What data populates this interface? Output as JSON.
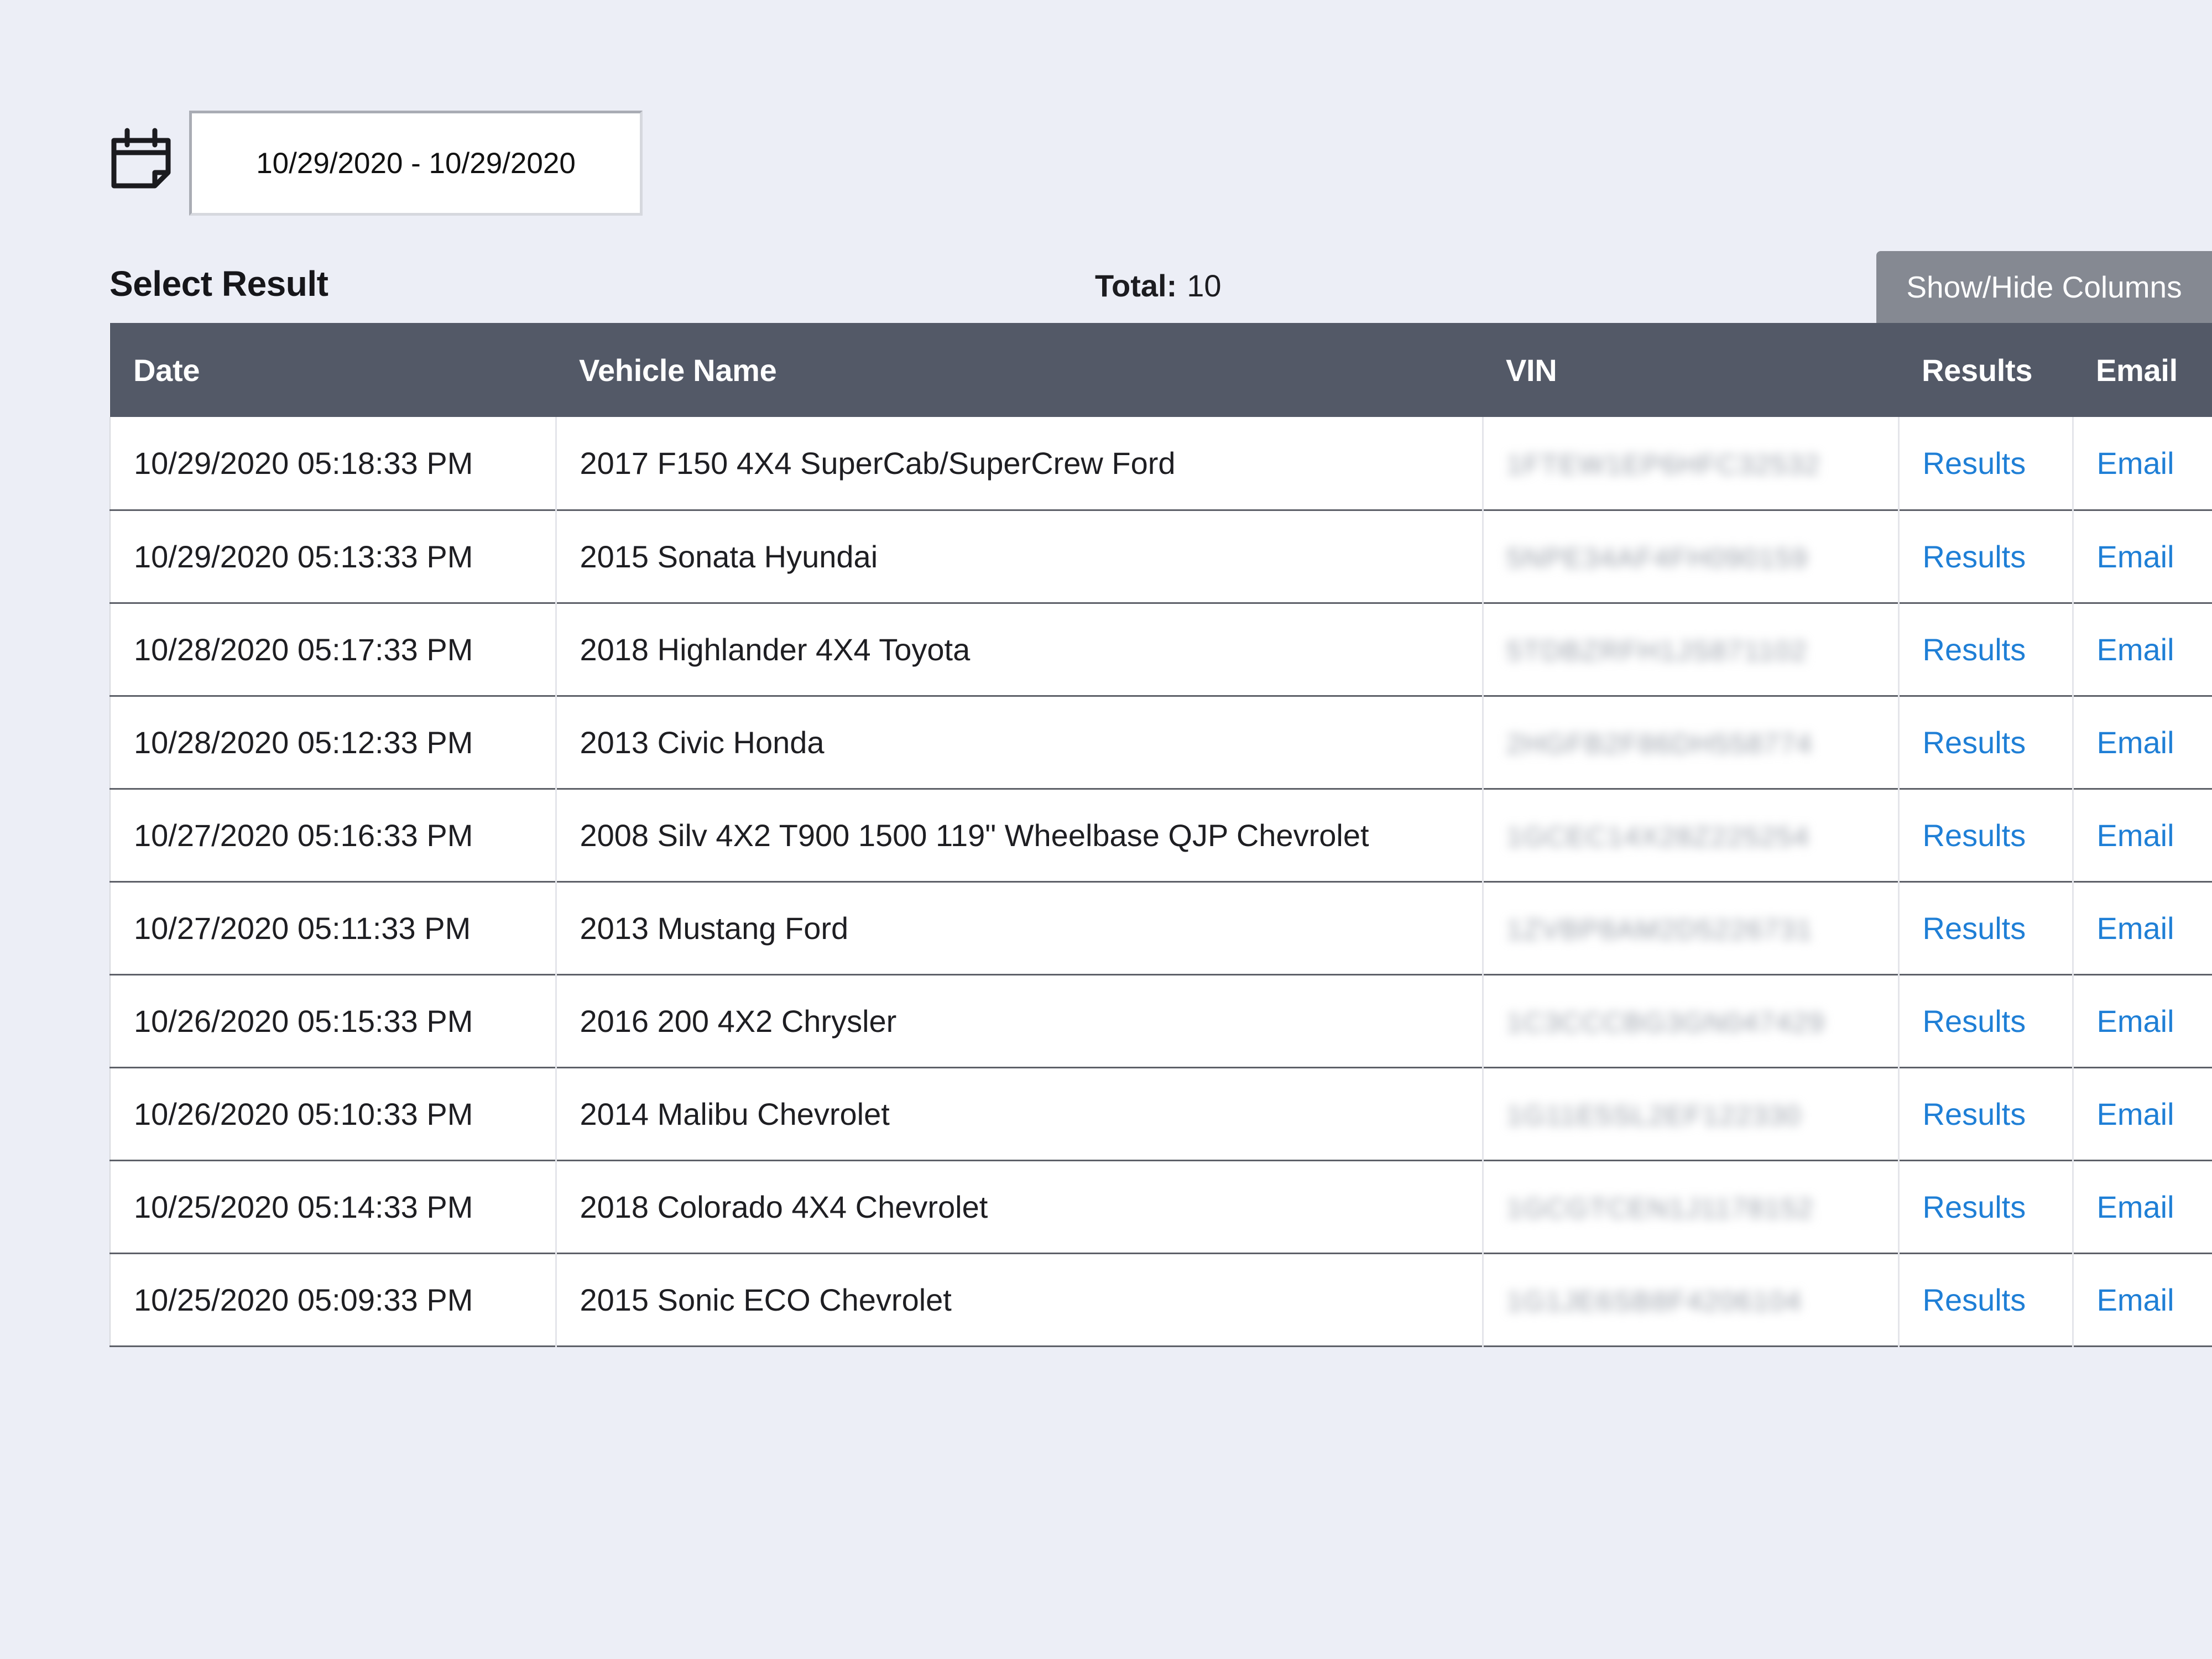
{
  "filter": {
    "date_range": "10/29/2020 - 10/29/2020"
  },
  "summary": {
    "title": "Select Result",
    "total_label": "Total:",
    "total_value": "10",
    "columns_button": "Show/Hide Columns"
  },
  "table": {
    "headers": [
      "Date",
      "Vehicle Name",
      "VIN",
      "Results",
      "Email"
    ],
    "rows": [
      {
        "date": "10/29/2020 05:18:33 PM",
        "vehicle": "2017 F150 4X4 SuperCab/SuperCrew Ford",
        "vin": "1FTEW1EP6HFC32532",
        "results": "Results",
        "email": "Email"
      },
      {
        "date": "10/29/2020 05:13:33 PM",
        "vehicle": "2015 Sonata Hyundai",
        "vin": "5NPE34AF4FH090159",
        "results": "Results",
        "email": "Email"
      },
      {
        "date": "10/28/2020 05:17:33 PM",
        "vehicle": "2018 Highlander 4X4 Toyota",
        "vin": "5TDBZRFH1JS871102",
        "results": "Results",
        "email": "Email"
      },
      {
        "date": "10/28/2020 05:12:33 PM",
        "vehicle": "2013 Civic Honda",
        "vin": "2HGFB2F86DH558774",
        "results": "Results",
        "email": "Email"
      },
      {
        "date": "10/27/2020 05:16:33 PM",
        "vehicle": "2008 Silv 4X2 T900 1500 119\" Wheelbase QJP Chevrolet",
        "vin": "1GCEC14X28Z225254",
        "results": "Results",
        "email": "Email"
      },
      {
        "date": "10/27/2020 05:11:33 PM",
        "vehicle": "2013 Mustang Ford",
        "vin": "1ZVBP8AM2D5226731",
        "results": "Results",
        "email": "Email"
      },
      {
        "date": "10/26/2020 05:15:33 PM",
        "vehicle": "2016 200 4X2 Chrysler",
        "vin": "1C3CCCBG3GN047429",
        "results": "Results",
        "email": "Email"
      },
      {
        "date": "10/26/2020 05:10:33 PM",
        "vehicle": "2014 Malibu Chevrolet",
        "vin": "1G11E5SL2EF122330",
        "results": "Results",
        "email": "Email"
      },
      {
        "date": "10/25/2020 05:14:33 PM",
        "vehicle": "2018 Colorado 4X4 Chevrolet",
        "vin": "1GCGTCEN1J1178152",
        "results": "Results",
        "email": "Email"
      },
      {
        "date": "10/25/2020 05:09:33 PM",
        "vehicle": "2015 Sonic ECO Chevrolet",
        "vin": "1G1JE6SB8F4206104",
        "results": "Results",
        "email": "Email"
      }
    ]
  },
  "icons": {
    "date_picker": "calendar-icon"
  },
  "colors": {
    "background": "#eceef6",
    "header_bg": "#535967",
    "button_bg": "#858992",
    "link": "#1f7fd6"
  }
}
